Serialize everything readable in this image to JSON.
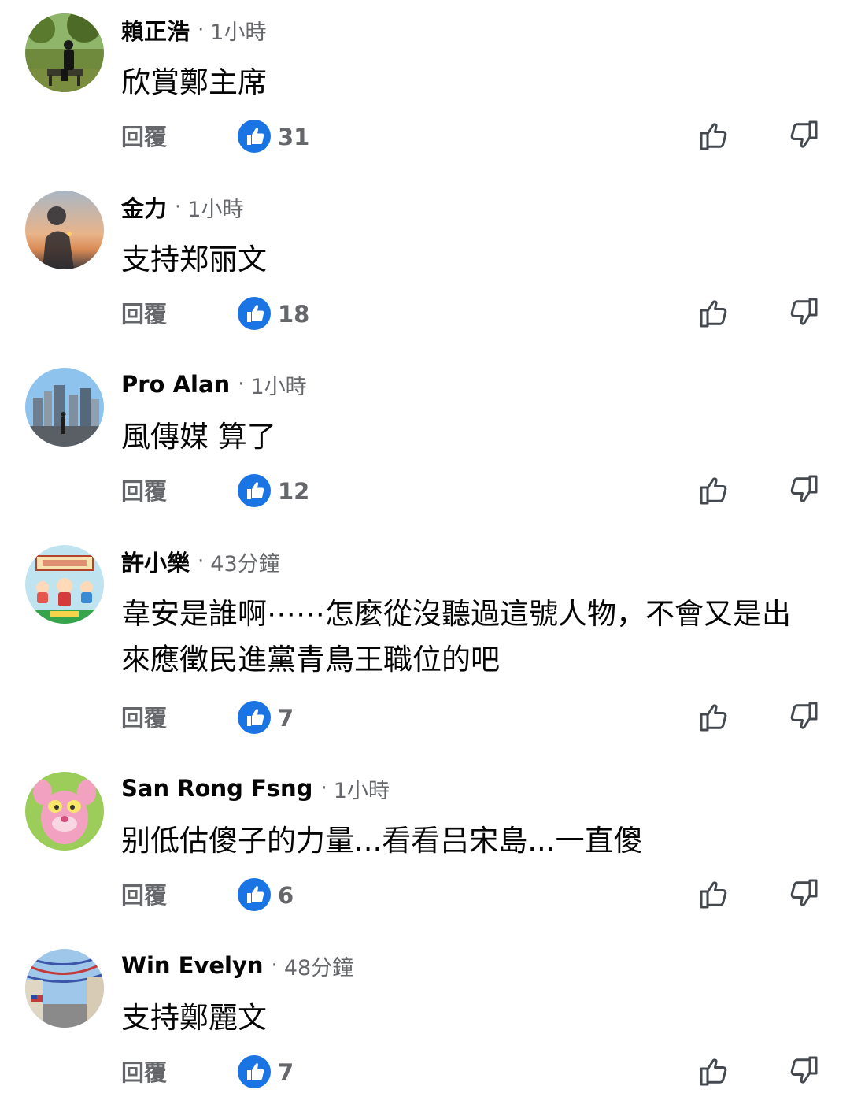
{
  "comments": [
    {
      "author": "賴正浩",
      "time": "1小時",
      "text": "欣賞鄭主席",
      "reply_label": "回覆",
      "like_count": "31",
      "avatar": "man-on-bench-in-park-photo"
    },
    {
      "author": "金力",
      "time": "1小時",
      "text": "支持郑丽文",
      "reply_label": "回覆",
      "like_count": "18",
      "avatar": "silhouette-at-sunset-photo"
    },
    {
      "author": "Pro Alan",
      "time": "1小時",
      "text": "風傳媒 算了",
      "reply_label": "回覆",
      "like_count": "12",
      "avatar": "city-skyline-photo"
    },
    {
      "author": "許小樂",
      "time": "43分鐘",
      "text": "韋安是誰啊⋯⋯怎麼從沒聽過這號人物，不會又是出來應徵民進黨青鳥王職位的吧",
      "reply_label": "回覆",
      "like_count": "7",
      "avatar": "cartoon-children-greeting-card"
    },
    {
      "author": "San Rong Fsng",
      "time": "1小時",
      "text": "别低估傻子的力量...看看吕宋島...一直傻",
      "reply_label": "回覆",
      "like_count": "6",
      "avatar": "pink-panther-cartoon"
    },
    {
      "author": "Win Evelyn",
      "time": "48分鐘",
      "text": "支持鄭麗文",
      "reply_label": "回覆",
      "like_count": "7",
      "avatar": "street-with-flags-photo"
    }
  ],
  "colors": {
    "reaction_blue": "#1b74e4",
    "secondary_text": "#65676b",
    "primary_text": "#050505"
  }
}
